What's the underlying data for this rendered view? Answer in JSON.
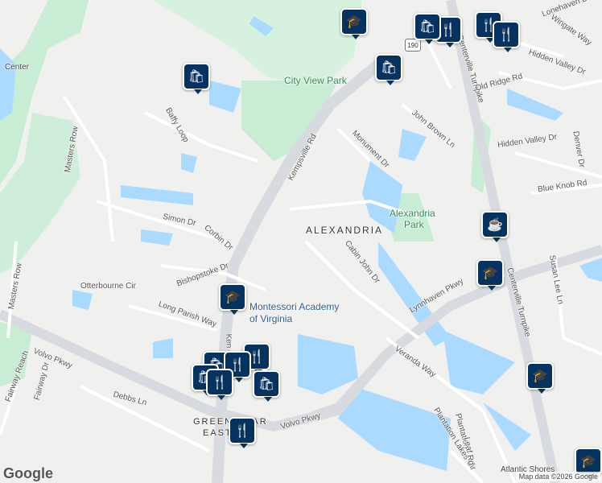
{
  "map": {
    "places": {
      "alexandria": "ALEXANDRIA",
      "greenbriar_1": "GREENBRIAR",
      "greenbriar_2": "EAST",
      "city_view_park": "City View Park",
      "alexandria_park_1": "Alexandria",
      "alexandria_park_2": "Park",
      "montessori_1": "Montessori Academy",
      "montessori_2": "of Virginia",
      "atlantic": "Atlantic Shores"
    },
    "roads": {
      "kempsville": "Kempsville Rd",
      "centerville_1": "Centerville Turnpike",
      "centerville_2": "Centerville Turnpike",
      "lynnhaven": "Lynnhaven Pkwy",
      "volvo_1": "Volvo Pkwy",
      "volvo_2": "Volvo Pkwy",
      "masters_row_1": "Masters Row",
      "masters_row_2": "Masters Row",
      "baffy": "Baffy Loop",
      "simon": "Simon Dr",
      "corbin": "Corbin Dr",
      "bishopstoke": "Bishopstoke Dr",
      "long_parish": "Long Parish Way",
      "debbs": "Debbs Ln",
      "fairway_reach": "Fairway Reach",
      "fairway_dr": "Fairway Dr",
      "otterbourne": "Otterbourne Cir",
      "monument": "Monument Dr",
      "john_brown": "John Brown Ln",
      "cabin_john": "Cabin John Dr",
      "veranda": "Veranda Way",
      "plantation_lakes": "Plantation Lakes Cir",
      "plantation_1": "Plantation",
      "leaf": "Leaf Rd",
      "old_ridge": "Old Ridge Rd",
      "hidden_valley_1": "Hidden Valley Dr",
      "hidden_valley_2": "Hidden Valley Dr",
      "denver": "Denver Dr",
      "blue_knob": "Blue Knob Rd",
      "susan_lee": "Susan Lee Ln",
      "wingate": "Wingate Way",
      "lonehaven": "Lonehaven Dr",
      "kempsville_short": "Ken",
      "center_clip": "Center",
      "route_190": "190"
    },
    "pins": [
      {
        "name": "school",
        "icon": "school-icon",
        "glyph": "🎓"
      },
      {
        "name": "shopping",
        "icon": "shopping-bag-icon",
        "glyph": "🛍"
      },
      {
        "name": "shopping",
        "icon": "shopping-bag-icon",
        "glyph": "🛍"
      },
      {
        "name": "cafe",
        "icon": "coffee-cup-icon",
        "glyph": "☕"
      },
      {
        "name": "school",
        "icon": "school-icon",
        "glyph": "🎓"
      },
      {
        "name": "school",
        "icon": "school-icon",
        "glyph": "🎓"
      },
      {
        "name": "school",
        "icon": "school-icon",
        "glyph": "🎓"
      },
      {
        "name": "restaurant",
        "icon": "fork-knife-icon",
        "glyph": "🍴"
      },
      {
        "name": "restaurant",
        "icon": "fork-knife-icon",
        "glyph": "🍴"
      },
      {
        "name": "shopping",
        "icon": "shopping-bag-icon",
        "glyph": "🛍"
      },
      {
        "name": "restaurant",
        "icon": "fork-knife-icon",
        "glyph": "🍴"
      },
      {
        "name": "restaurant",
        "icon": "fork-knife-icon",
        "glyph": "🍴"
      },
      {
        "name": "shopping",
        "icon": "shopping-bag-icon",
        "glyph": "🛍"
      },
      {
        "name": "restaurant",
        "icon": "fork-knife-icon",
        "glyph": "🍴"
      },
      {
        "name": "shopping",
        "icon": "shopping-bag-icon",
        "glyph": "🛍"
      },
      {
        "name": "shopping",
        "icon": "shopping-bag-icon",
        "glyph": "🛍"
      },
      {
        "name": "restaurant",
        "icon": "fork-knife-icon",
        "glyph": "🍴"
      },
      {
        "name": "restaurant",
        "icon": "fork-knife-icon",
        "glyph": "🍴"
      },
      {
        "name": "restaurant",
        "icon": "fork-knife-icon",
        "glyph": "🍴"
      }
    ],
    "logo": "Google",
    "attribution": "Map data ©2026 Google",
    "colors": {
      "water": "#aadaff",
      "park": "#c8ecd4",
      "pin": "#06325f",
      "road": "#ffffff",
      "major_road": "#d7dbe0"
    }
  }
}
